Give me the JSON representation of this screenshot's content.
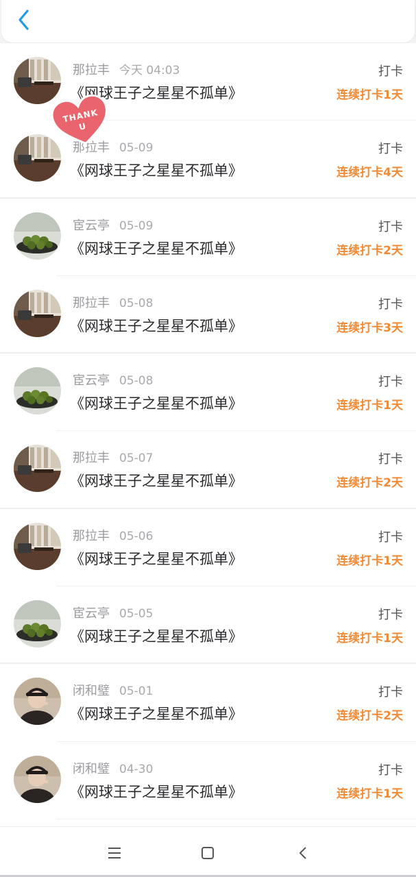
{
  "header": {
    "back_icon": "chevron-left-icon",
    "accent": "#1e9be6"
  },
  "sticker": {
    "text": "THANK U",
    "color": "#e9646d"
  },
  "items": [
    {
      "user": "那拉丰",
      "date": "今天 04:03",
      "title": "《网球王子之星星不孤单》",
      "tag": "打卡",
      "streak": "连续打卡1天",
      "avatar": "desk"
    },
    {
      "user": "那拉丰",
      "date": "05-09",
      "title": "《网球王子之星星不孤单》",
      "tag": "打卡",
      "streak": "连续打卡4天",
      "avatar": "desk"
    },
    {
      "user": "宦云亭",
      "date": "05-09",
      "title": "《网球王子之星星不孤单》",
      "tag": "打卡",
      "streak": "连续打卡2天",
      "avatar": "fruit"
    },
    {
      "user": "那拉丰",
      "date": "05-08",
      "title": "《网球王子之星星不孤单》",
      "tag": "打卡",
      "streak": "连续打卡3天",
      "avatar": "desk"
    },
    {
      "user": "宦云亭",
      "date": "05-08",
      "title": "《网球王子之星星不孤单》",
      "tag": "打卡",
      "streak": "连续打卡1天",
      "avatar": "fruit"
    },
    {
      "user": "那拉丰",
      "date": "05-07",
      "title": "《网球王子之星星不孤单》",
      "tag": "打卡",
      "streak": "连续打卡2天",
      "avatar": "desk"
    },
    {
      "user": "那拉丰",
      "date": "05-06",
      "title": "《网球王子之星星不孤单》",
      "tag": "打卡",
      "streak": "连续打卡1天",
      "avatar": "desk"
    },
    {
      "user": "宦云亭",
      "date": "05-05",
      "title": "《网球王子之星星不孤单》",
      "tag": "打卡",
      "streak": "连续打卡1天",
      "avatar": "fruit"
    },
    {
      "user": "闭和璧",
      "date": "05-01",
      "title": "《网球王子之星星不孤单》",
      "tag": "打卡",
      "streak": "连续打卡2天",
      "avatar": "person"
    },
    {
      "user": "闭和璧",
      "date": "04-30",
      "title": "《网球王子之星星不孤单》",
      "tag": "打卡",
      "streak": "连续打卡1天",
      "avatar": "person"
    }
  ],
  "colors": {
    "streak": "#f28a35",
    "title": "#2a2a2e",
    "meta": "#9b9ba0"
  },
  "navbar": {
    "icons": [
      "menu-icon",
      "home-square-icon",
      "back-chevron-icon"
    ]
  }
}
